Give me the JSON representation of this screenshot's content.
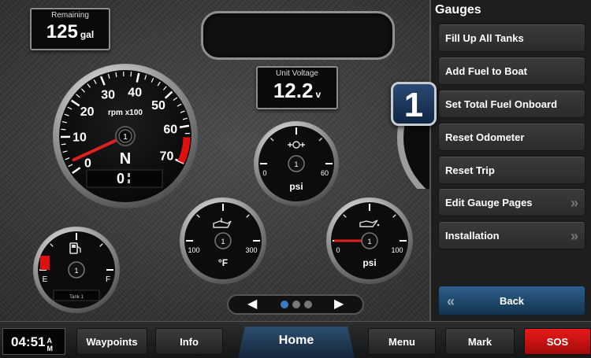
{
  "remaining": {
    "label": "Remaining",
    "value": "125",
    "unit": "gal"
  },
  "voltage": {
    "label": "Unit Voltage",
    "value": "12.2",
    "unit": "v"
  },
  "tach": {
    "ticks": [
      "0",
      "10",
      "20",
      "30",
      "40",
      "50",
      "60",
      "70"
    ],
    "unit_label": "rpm x100",
    "gear": "N",
    "center": "1",
    "digital_value": "0",
    "needle_value": 3,
    "redline_start": 63,
    "max": 70
  },
  "fuel_gauge": {
    "empty": "E",
    "full": "F",
    "tank_label": "Tank 1",
    "center": "1",
    "level": 0.05
  },
  "pressure_gauge": {
    "min": "0",
    "max": "60",
    "unit": "psi",
    "center": "1",
    "value": 0
  },
  "temp_gauge": {
    "min": "100",
    "max": "300",
    "unit": "°F",
    "center": "1",
    "value": 100
  },
  "oil_pressure_gauge": {
    "min": "0",
    "max": "100",
    "unit": "psi",
    "center": "1",
    "value": 0
  },
  "menu": {
    "title": "Gauges",
    "items": [
      {
        "label": "Fill Up All Tanks"
      },
      {
        "label": "Add Fuel to Boat"
      },
      {
        "label": "Set Total Fuel Onboard"
      },
      {
        "label": "Reset Odometer"
      },
      {
        "label": "Reset Trip"
      },
      {
        "label": "Edit Gauge Pages",
        "chevron": "»"
      },
      {
        "label": "Installation",
        "chevron": "»"
      }
    ],
    "back_label": "Back",
    "back_chevron": "«"
  },
  "badge": "1",
  "pager": {
    "prev": "◀",
    "next": "▶",
    "active_index": 0,
    "count": 3
  },
  "bottombar": {
    "time": "04:51",
    "ampm_top": "A",
    "ampm_bottom": "M",
    "waypoints": "Waypoints",
    "info": "Info",
    "home": "Home",
    "menu": "Menu",
    "mark": "Mark",
    "sos": "SOS"
  },
  "colors": {
    "redline": "#e01010",
    "needle": "#e02020",
    "accent": "#1a3a5c",
    "sos": "#d80f0f"
  }
}
